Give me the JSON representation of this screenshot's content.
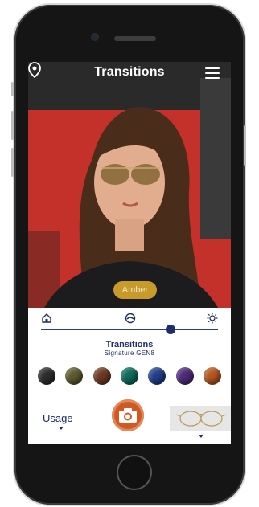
{
  "header": {
    "logo_text": "Transitions",
    "location_icon": "map-pin-icon",
    "menu_icon": "hamburger-menu-icon"
  },
  "tint": {
    "selected_label": "Amber"
  },
  "slider": {
    "left_icon": "indoor-house-icon",
    "middle_icon": "car-icon",
    "right_icon": "sun-icon",
    "level": 0.73
  },
  "brand": {
    "line1": "Transitions",
    "line2": "Signature GEN8"
  },
  "swatches": [
    {
      "name": "grey",
      "color": "#2d2d2d"
    },
    {
      "name": "graphite green",
      "color": "#5b5a2e"
    },
    {
      "name": "brown",
      "color": "#6d3a22"
    },
    {
      "name": "emerald",
      "color": "#0f6a5a"
    },
    {
      "name": "sapphire",
      "color": "#1e3f8a"
    },
    {
      "name": "amethyst",
      "color": "#4f2a7a"
    },
    {
      "name": "amber",
      "color": "#b5561f"
    }
  ],
  "bottom": {
    "usage_label": "Usage",
    "camera_icon": "camera-icon",
    "frames_icon": "eyeglasses-frames-icon"
  },
  "colors": {
    "brand_navy": "#1e2d6b",
    "accent_orange": "#d25a22",
    "tint_pill": "#c89a2a"
  }
}
